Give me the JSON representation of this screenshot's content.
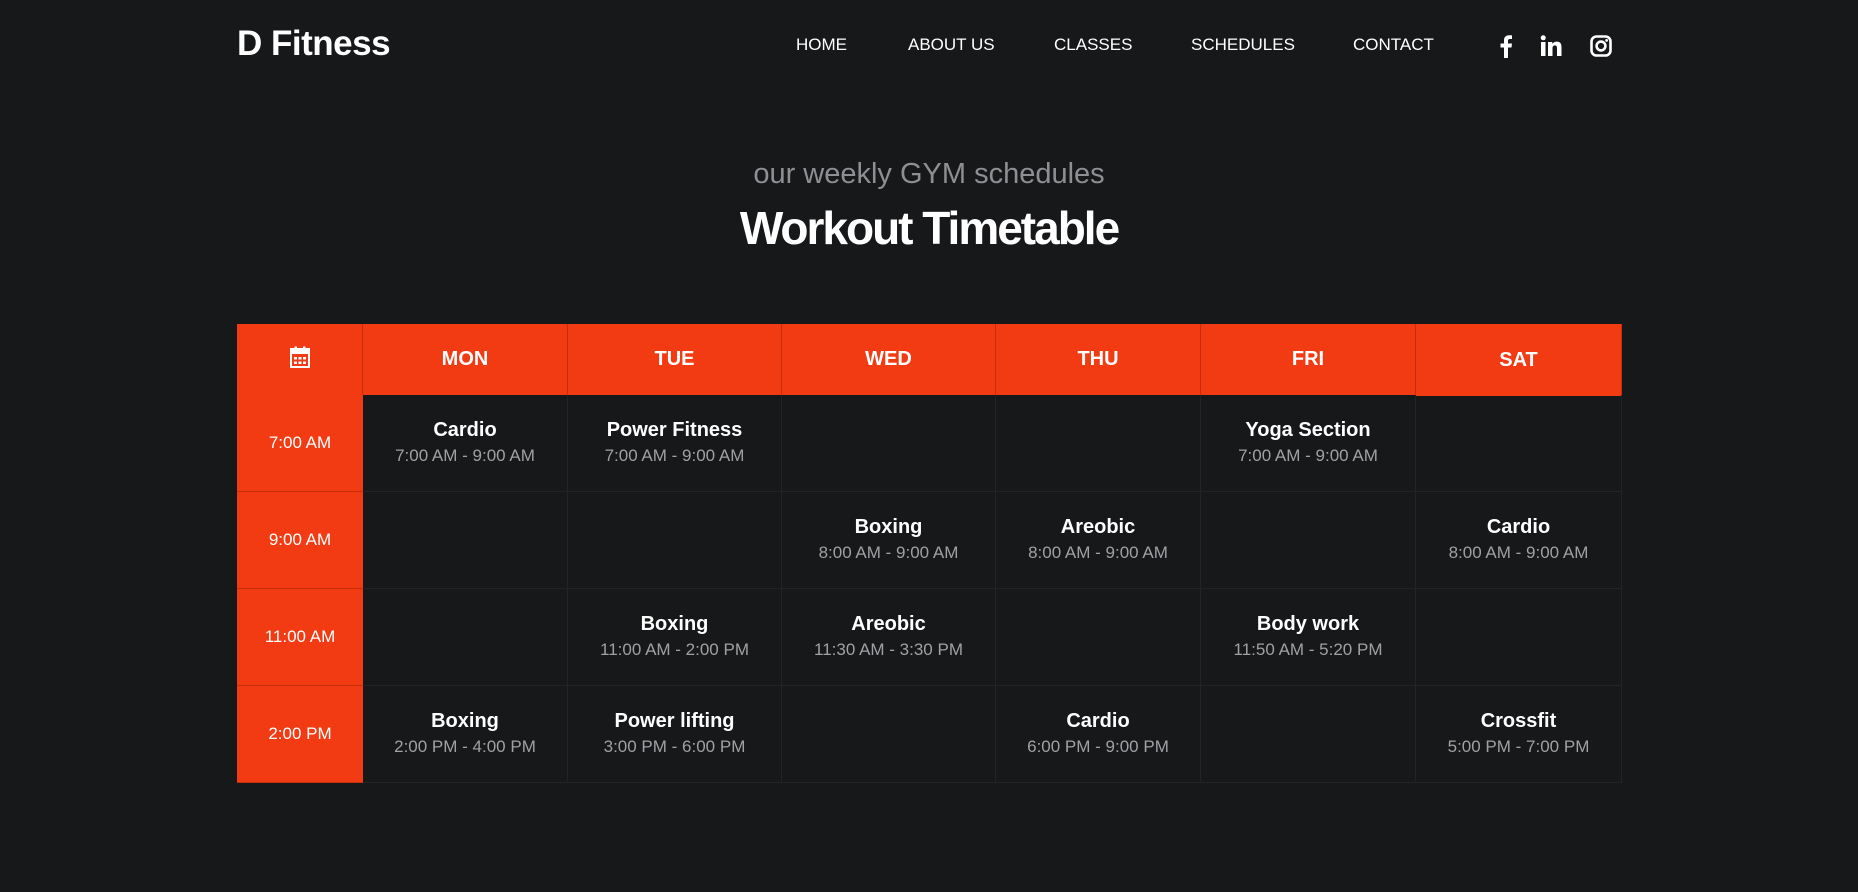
{
  "brand": {
    "logo": "D Fitness"
  },
  "nav": {
    "items": [
      {
        "label": "HOME",
        "name": "nav-home"
      },
      {
        "label": "ABOUT US",
        "name": "nav-about-us"
      },
      {
        "label": "CLASSES",
        "name": "nav-classes"
      },
      {
        "label": "SCHEDULES",
        "name": "nav-schedules"
      },
      {
        "label": "CONTACT",
        "name": "nav-contact"
      }
    ],
    "social": [
      "facebook-icon",
      "linkedin-icon",
      "instagram-icon"
    ]
  },
  "section": {
    "subtitle": "our weekly GYM schedules",
    "title": "Workout Timetable"
  },
  "timetable": {
    "corner_icon": "calendar-icon",
    "days": [
      "MON",
      "TUE",
      "WED",
      "THU",
      "FRI",
      "SAT"
    ],
    "times": [
      "7:00 AM",
      "9:00 AM",
      "11:00 AM",
      "2:00 PM"
    ],
    "rows": [
      [
        {
          "name": "Cardio",
          "time": "7:00 AM - 9:00 AM"
        },
        {
          "name": "Power Fitness",
          "time": "7:00 AM - 9:00 AM"
        },
        null,
        null,
        {
          "name": "Yoga Section",
          "time": "7:00 AM - 9:00 AM"
        },
        null
      ],
      [
        null,
        null,
        {
          "name": "Boxing",
          "time": "8:00 AM - 9:00 AM"
        },
        {
          "name": "Areobic",
          "time": "8:00 AM - 9:00 AM"
        },
        null,
        {
          "name": "Cardio",
          "time": "8:00 AM - 9:00 AM"
        }
      ],
      [
        null,
        {
          "name": "Boxing",
          "time": "11:00 AM - 2:00 PM"
        },
        {
          "name": "Areobic",
          "time": "11:30 AM - 3:30 PM"
        },
        null,
        {
          "name": "Body work",
          "time": "11:50 AM - 5:20 PM"
        },
        null
      ],
      [
        {
          "name": "Boxing",
          "time": "2:00 PM - 4:00 PM"
        },
        {
          "name": "Power lifting",
          "time": "3:00 PM - 6:00 PM"
        },
        null,
        {
          "name": "Cardio",
          "time": "6:00 PM - 9:00 PM"
        },
        null,
        {
          "name": "Crossfit",
          "time": "5:00 PM - 7:00 PM"
        }
      ]
    ]
  },
  "colors": {
    "background": "#17181a",
    "accent": "#f23a13",
    "muted_text": "#a0a1a4"
  }
}
